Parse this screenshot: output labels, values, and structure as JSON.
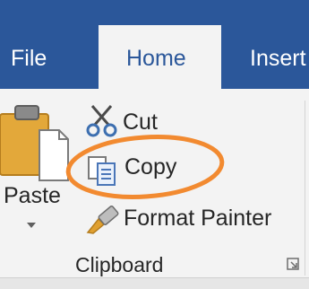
{
  "tabs": {
    "file": "File",
    "home": "Home",
    "insert": "Insert"
  },
  "clipboard": {
    "paste_label": "Paste",
    "cut_label": "Cut",
    "copy_label": "Copy",
    "format_painter_label": "Format Painter",
    "group_label": "Clipboard"
  },
  "icons": {
    "paste": "clipboard-paste-icon",
    "paste_dropdown": "chevron-down-icon",
    "cut": "scissors-icon",
    "copy": "copy-icon",
    "format_painter": "paintbrush-icon",
    "dialog_launcher": "dialog-launcher-icon"
  },
  "colors": {
    "ribbon_tab_bar": "#2b579a",
    "ribbon_body": "#f3f3f3",
    "highlight": "#f28a30"
  }
}
